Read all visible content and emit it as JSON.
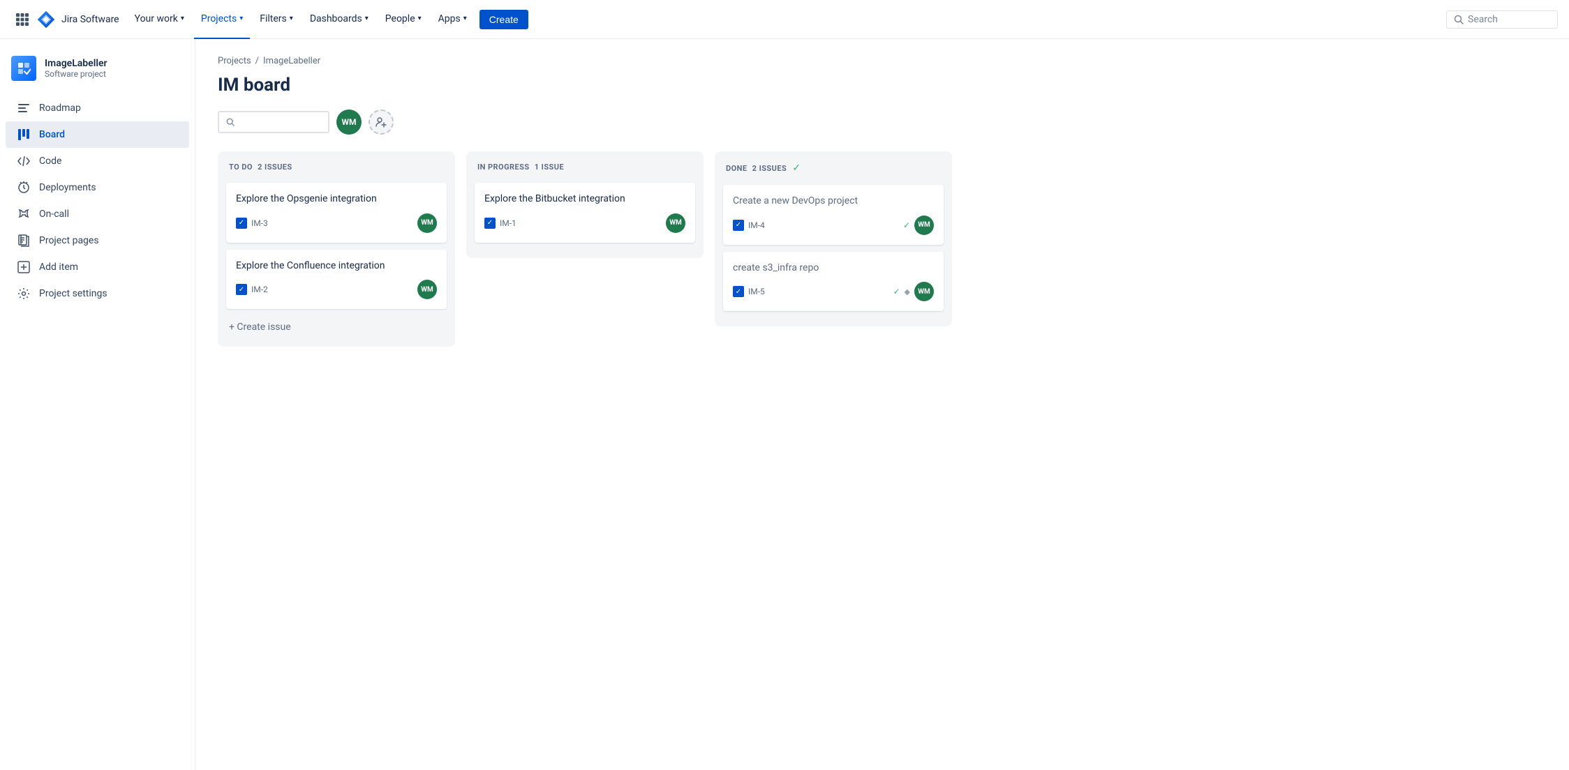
{
  "topnav": {
    "logo_text": "Jira Software",
    "nav_items": [
      {
        "label": "Your work",
        "has_chevron": true,
        "active": false
      },
      {
        "label": "Projects",
        "has_chevron": true,
        "active": true
      },
      {
        "label": "Filters",
        "has_chevron": true,
        "active": false
      },
      {
        "label": "Dashboards",
        "has_chevron": true,
        "active": false
      },
      {
        "label": "People",
        "has_chevron": true,
        "active": false
      },
      {
        "label": "Apps",
        "has_chevron": true,
        "active": false
      }
    ],
    "create_label": "Create",
    "search_placeholder": "Search"
  },
  "sidebar": {
    "project_name": "ImageLabeller",
    "project_type": "Software project",
    "nav_items": [
      {
        "label": "Roadmap",
        "icon": "≡",
        "active": false
      },
      {
        "label": "Board",
        "icon": "▦",
        "active": true
      },
      {
        "label": "Code",
        "icon": "</>",
        "active": false
      },
      {
        "label": "Deployments",
        "icon": "⬆",
        "active": false
      },
      {
        "label": "On-call",
        "icon": "📞",
        "active": false
      },
      {
        "label": "Project pages",
        "icon": "📄",
        "active": false
      },
      {
        "label": "Add item",
        "icon": "⊞",
        "active": false
      },
      {
        "label": "Project settings",
        "icon": "⚙",
        "active": false
      }
    ]
  },
  "breadcrumb": {
    "items": [
      {
        "label": "Projects",
        "link": true
      },
      {
        "label": "ImageLabeller",
        "link": true
      }
    ]
  },
  "board": {
    "title": "IM board",
    "avatar_initials": "WM",
    "columns": [
      {
        "title": "TO DO",
        "issue_count": "2 ISSUES",
        "done": false,
        "cards": [
          {
            "title": "Explore the Opsgenie integration",
            "id": "IM-3",
            "avatar_initials": "WM"
          },
          {
            "title": "Explore the Confluence integration",
            "id": "IM-2",
            "avatar_initials": "WM"
          }
        ],
        "create_issue_label": "+ Create issue"
      },
      {
        "title": "IN PROGRESS",
        "issue_count": "1 ISSUE",
        "done": false,
        "cards": [
          {
            "title": "Explore the Bitbucket integration",
            "id": "IM-1",
            "avatar_initials": "WM"
          }
        ],
        "create_issue_label": null
      },
      {
        "title": "DONE",
        "issue_count": "2 ISSUES",
        "done": true,
        "cards": [
          {
            "title": "Create a new DevOps project",
            "id": "IM-4",
            "avatar_initials": "WM",
            "has_story": false
          },
          {
            "title": "create s3_infra repo",
            "id": "IM-5",
            "avatar_initials": "WM",
            "has_story": true
          }
        ],
        "create_issue_label": null
      }
    ]
  }
}
